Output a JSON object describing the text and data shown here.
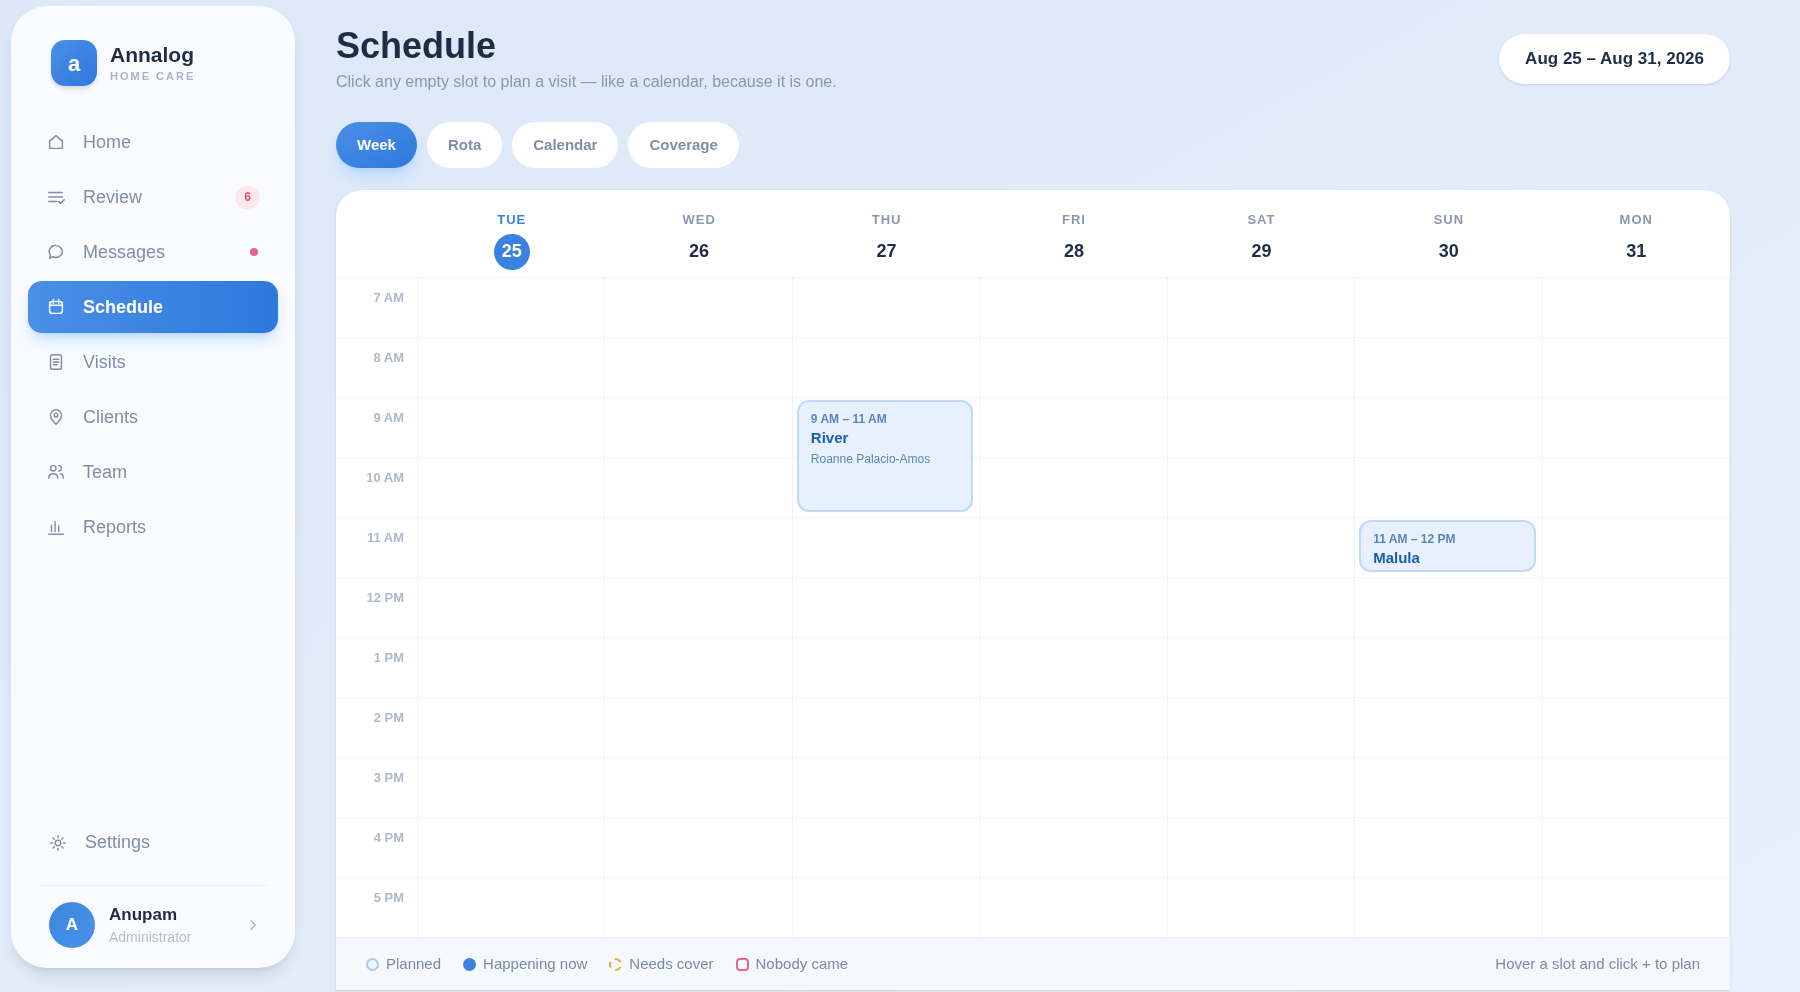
{
  "brand": {
    "logo_letter": "a",
    "name": "Annalog",
    "tagline": "HOME CARE"
  },
  "nav": [
    {
      "label": "Home",
      "selected": false
    },
    {
      "label": "Review",
      "selected": false,
      "badge": "6"
    },
    {
      "label": "Messages",
      "selected": false,
      "dot": true
    },
    {
      "label": "Schedule",
      "selected": true
    },
    {
      "label": "Visits",
      "selected": false
    },
    {
      "label": "Clients",
      "selected": false
    },
    {
      "label": "Team",
      "selected": false
    },
    {
      "label": "Reports",
      "selected": false
    }
  ],
  "settings": {
    "label": "Settings"
  },
  "user": {
    "initial": "A",
    "name": "Anupam",
    "role": "Administrator"
  },
  "header": {
    "title": "Schedule",
    "subtitle": "Click any empty slot to plan a visit — like a calendar, because it is one.",
    "date_range": "Aug 25 – Aug 31, 2026"
  },
  "tabs": [
    {
      "label": "Week",
      "selected": true
    },
    {
      "label": "Rota",
      "selected": false
    },
    {
      "label": "Calendar",
      "selected": false
    },
    {
      "label": "Coverage",
      "selected": false
    }
  ],
  "hours": [
    "7 AM",
    "8 AM",
    "9 AM",
    "10 AM",
    "11 AM",
    "12 PM",
    "1 PM",
    "2 PM",
    "3 PM",
    "4 PM",
    "5 PM"
  ],
  "days": [
    {
      "weekday": "TUE",
      "date": "25",
      "selected": true
    },
    {
      "weekday": "WED",
      "date": "26",
      "selected": false
    },
    {
      "weekday": "THU",
      "date": "27",
      "selected": false,
      "slots": [
        {
          "kind": "free"
        },
        {
          "kind": "free"
        },
        {
          "kind": "visit",
          "time": "9 AM – 11 AM",
          "client": "River",
          "carer": "Roanne Palacio-Amos"
        },
        {
          "kind": "continued"
        },
        {
          "kind": "free"
        },
        {
          "kind": "free"
        },
        {
          "kind": "free"
        },
        {
          "kind": "free"
        },
        {
          "kind": "free"
        },
        {
          "kind": "free"
        },
        {
          "kind": "free"
        }
      ]
    },
    {
      "weekday": "FRI",
      "date": "28",
      "selected": false
    },
    {
      "weekday": "SAT",
      "date": "29",
      "selected": false
    },
    {
      "weekday": "SUN",
      "date": "30",
      "selected": false,
      "slots": [
        {
          "kind": "free"
        },
        {
          "kind": "free"
        },
        {
          "kind": "free"
        },
        {
          "kind": "free"
        },
        {
          "kind": "visit",
          "time": "11 AM – 12 PM",
          "client": "Malula"
        },
        {
          "kind": "free"
        },
        {
          "kind": "free"
        },
        {
          "kind": "free"
        },
        {
          "kind": "free"
        },
        {
          "kind": "free"
        },
        {
          "kind": "free"
        }
      ]
    },
    {
      "weekday": "MON",
      "date": "31",
      "selected": false
    }
  ],
  "legend": [
    {
      "kind": "planned",
      "label": "Planned"
    },
    {
      "kind": "now",
      "label": "Happening now"
    },
    {
      "kind": "cover",
      "label": "Needs cover"
    },
    {
      "kind": "nobody",
      "label": "Nobody came"
    }
  ],
  "hint": "Hover a slot and click + to plan"
}
